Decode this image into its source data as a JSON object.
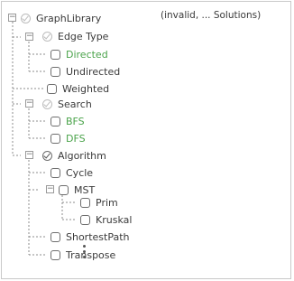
{
  "tree": {
    "root": {
      "label": "GraphLibrary",
      "annotation": "(invalid, ... Solutions)"
    },
    "edge_type": {
      "label": "Edge Type",
      "children": {
        "directed": "Directed",
        "undirected": "Undirected"
      }
    },
    "weighted": "Weighted",
    "search": {
      "label": "Search",
      "children": {
        "bfs": "BFS",
        "dfs": "DFS"
      }
    },
    "algorithm": {
      "label": "Algorithm",
      "cycle": "Cycle",
      "mst": {
        "label": "MST",
        "children": {
          "prim": "Prim",
          "kruskal": "Kruskal"
        }
      },
      "shortest_path": "ShortestPath",
      "transpose": "Transpose"
    }
  },
  "expander_symbols": {
    "collapse": "−"
  },
  "colors": {
    "selected_text": "#4aa34a",
    "text": "#3a3a3a",
    "line": "#8c8c8c"
  }
}
